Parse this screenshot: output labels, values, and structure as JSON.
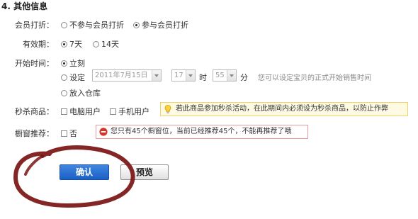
{
  "section": {
    "title": "4. 其他信息"
  },
  "member_discount": {
    "label": "会员打折：",
    "options": [
      "不参与会员打折",
      "参与会员打折"
    ],
    "selected_index": 1
  },
  "validity": {
    "label": "有效期：",
    "options": [
      "7天",
      "14天"
    ],
    "selected_index": 0
  },
  "start_time": {
    "label": "开始时间：",
    "options": [
      "立刻",
      "设定",
      "放入仓库"
    ],
    "selected_index": 0,
    "date_value": "2011年7月15日",
    "hour_value": "17",
    "hour_unit": "时",
    "minute_value": "55",
    "minute_unit": "分",
    "hint": "您可以设定宝贝的正式开始销售时间"
  },
  "flash_sale": {
    "label": "秒杀商品：",
    "options": [
      "电脑用户",
      "手机用户"
    ],
    "tip": "若此商品参加秒杀活动，在此期间内必须设为秒杀商品，以防止作弊",
    "tip_icon": "lightbulb-icon"
  },
  "window_recommend": {
    "label": "橱窗推荐：",
    "option": "否",
    "error": "您只有45个橱窗位，当前已经推荐45个，不能再推荐了哦",
    "error_icon": "no-entry-icon"
  },
  "buttons": {
    "confirm": "确认",
    "preview": "预览"
  },
  "colors": {
    "primary_button": "#1b5fc4",
    "tip_border": "#f1d26b",
    "error_border": "#e99a9a",
    "error_icon": "#d9322b",
    "annotation_stroke": "#7a1414"
  }
}
